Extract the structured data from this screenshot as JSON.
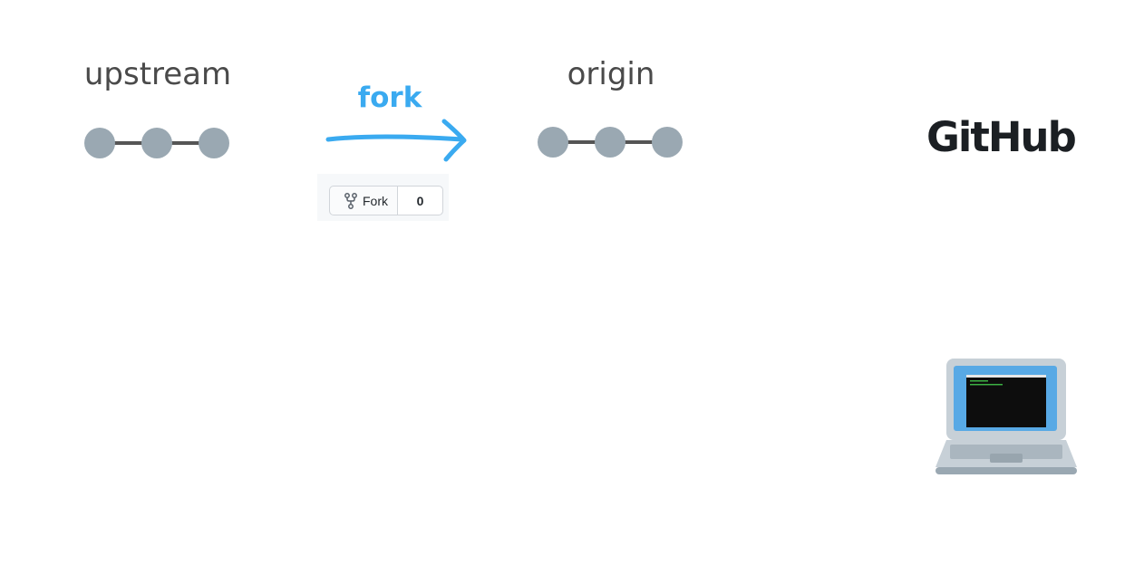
{
  "colors": {
    "accent": "#3aaaf0",
    "commit_node": "#9aa8b2",
    "commit_line": "#555555",
    "text": "#4a4a4a"
  },
  "upstream": {
    "label": "upstream",
    "commits": 3
  },
  "origin": {
    "label": "origin",
    "commits": 3
  },
  "fork": {
    "label": "fork",
    "button_label": "Fork",
    "count": "0",
    "icon": "repo-forked-icon"
  },
  "brand": {
    "logo_text": "GitHub"
  },
  "local": {
    "icon": "laptop-icon"
  }
}
